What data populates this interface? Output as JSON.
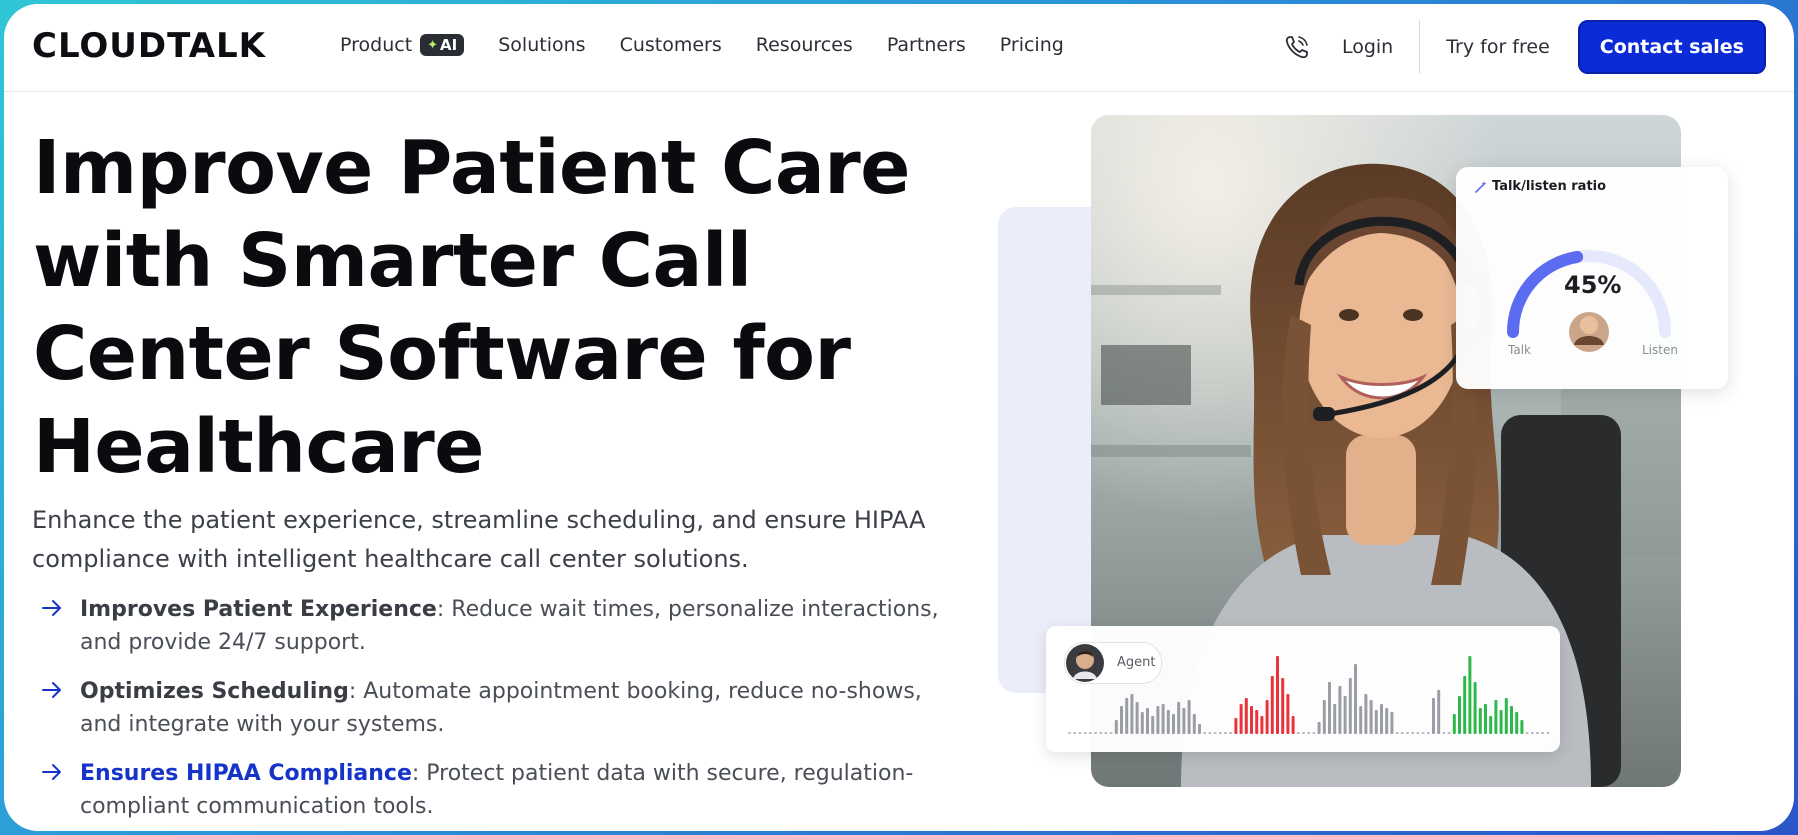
{
  "nav": {
    "logo": "CLOUDTALK",
    "items": [
      {
        "label": "Product",
        "badge": "AI"
      },
      {
        "label": "Solutions"
      },
      {
        "label": "Customers"
      },
      {
        "label": "Resources"
      },
      {
        "label": "Partners"
      },
      {
        "label": "Pricing"
      }
    ],
    "login": "Login",
    "try_free": "Try for free",
    "contact_sales": "Contact sales"
  },
  "hero": {
    "headline_lines": [
      "Improve Patient Care",
      "with Smarter Call",
      "Center Software for",
      "Healthcare"
    ],
    "subtitle": "Enhance the patient experience, streamline scheduling, and ensure HIPAA compliance with intelligent healthcare call center solutions.",
    "bullets": [
      {
        "title": "Improves Patient Experience",
        "text": ": Reduce wait times, personalize interactions, and provide 24/7 support."
      },
      {
        "title": "Optimizes Scheduling",
        "text": ": Automate appointment booking, reduce no-shows, and integrate with your systems."
      },
      {
        "title": "Ensures HIPAA Compliance",
        "text": ": Protect patient data with secure, regulation-compliant communication tools."
      }
    ]
  },
  "ratio_card": {
    "title": "Talk/listen ratio",
    "value": "45%",
    "fraction": 0.45,
    "talk_label": "Talk",
    "listen_label": "Listen"
  },
  "wave_card": {
    "agent_label": "Agent"
  },
  "colors": {
    "brand": "#0b2bd6",
    "link": "#1734c9",
    "gauge": "#5b6cf0",
    "wave_gray": "#9a9ca6",
    "wave_red": "#e8343a",
    "wave_green": "#2fb84a"
  },
  "icons": [
    "phone-icon",
    "arrow-right-icon",
    "sparkle-icon",
    "wand-icon"
  ]
}
